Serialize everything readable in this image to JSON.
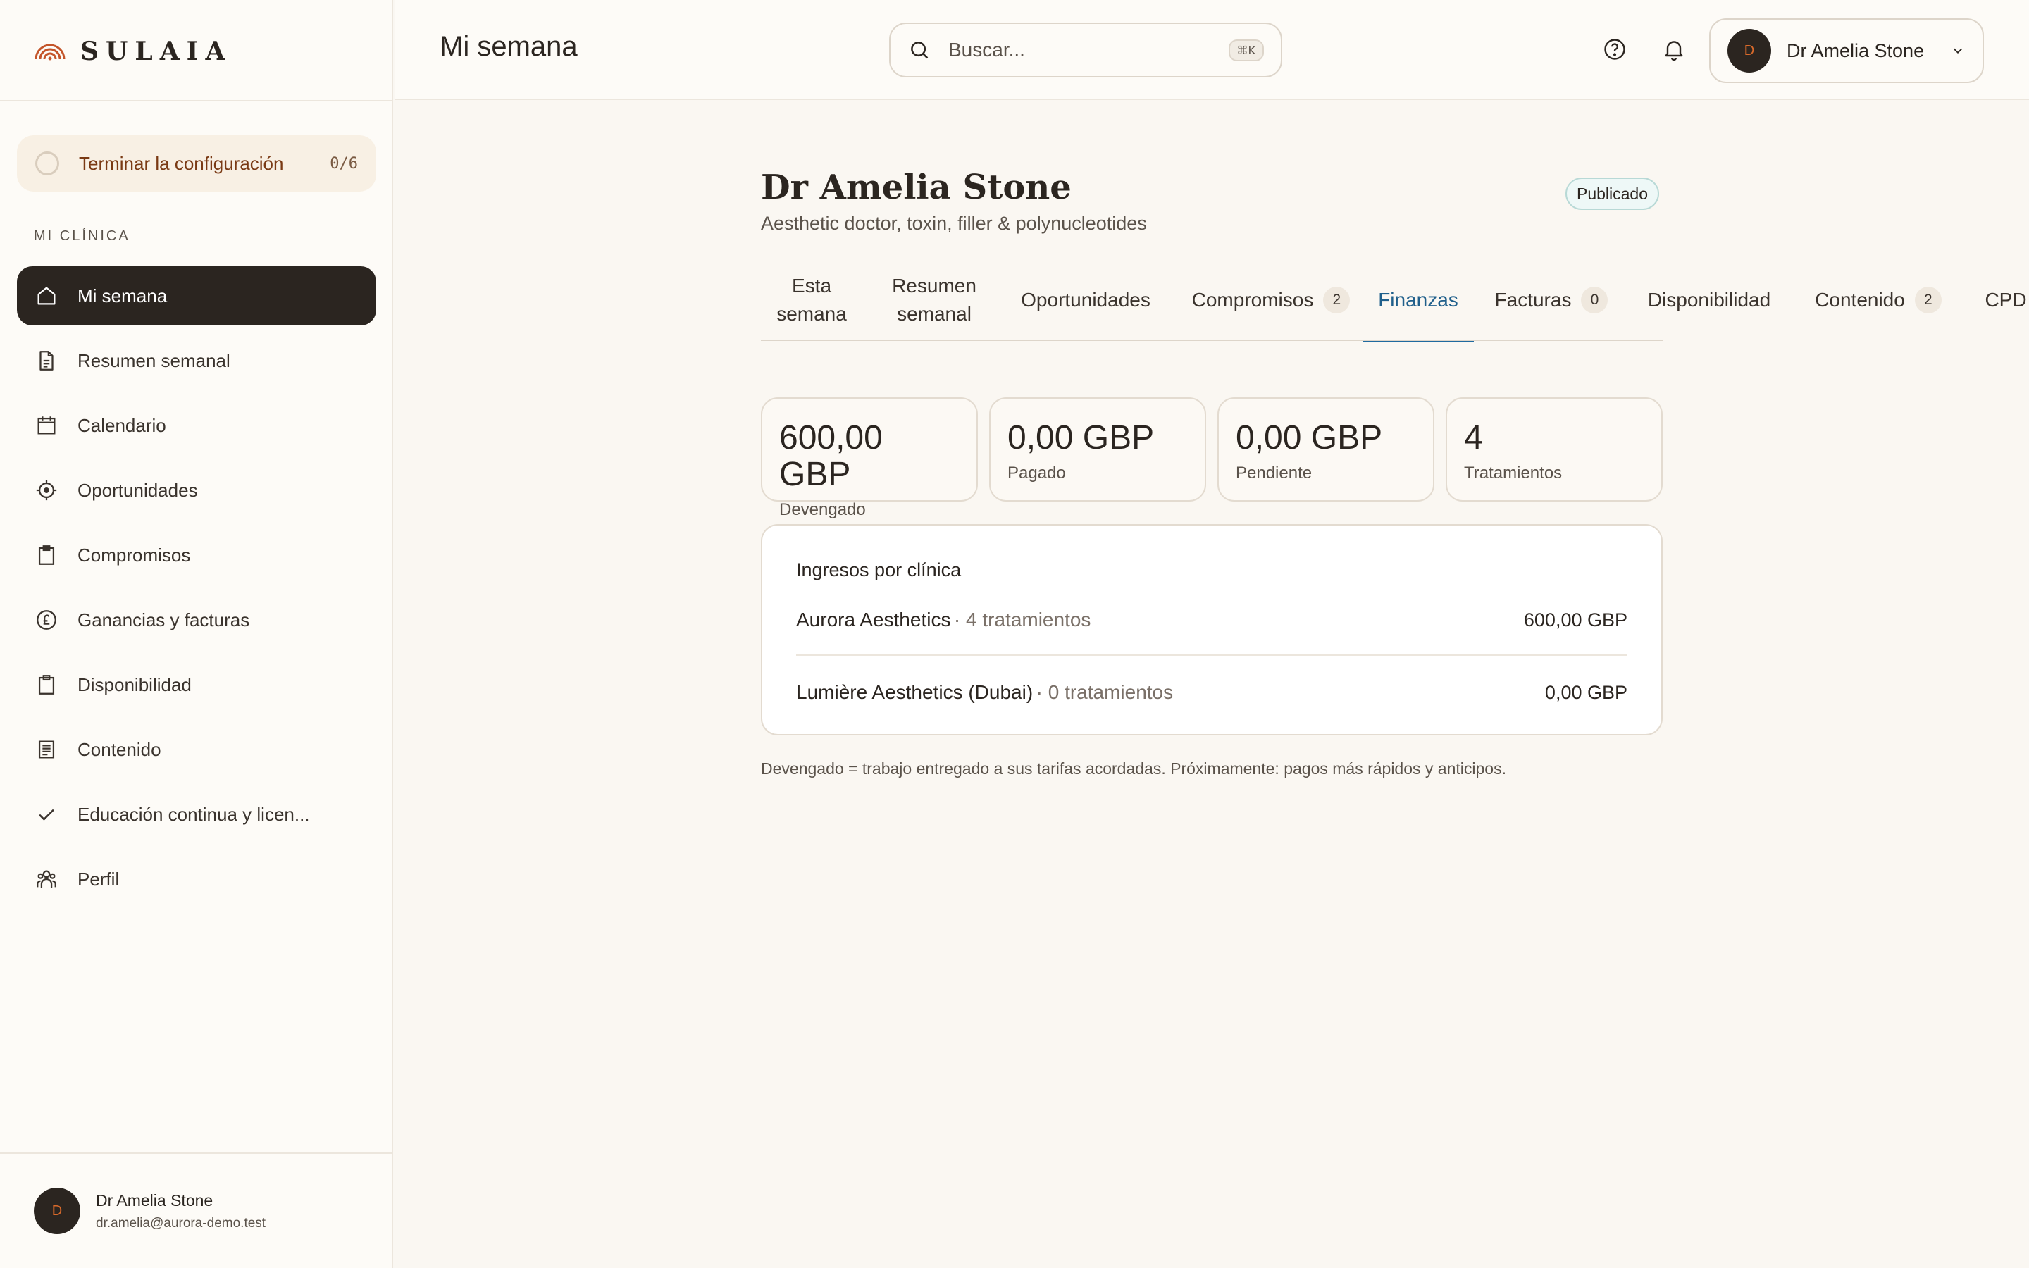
{
  "app": {
    "logo_text": "SULAIA"
  },
  "sidebar": {
    "setup": {
      "label": "Terminar la configuración",
      "count": "0/6"
    },
    "section_label": "MI CLÍNICA",
    "items": [
      {
        "label": "Mi semana",
        "icon": "home-icon"
      },
      {
        "label": "Resumen semanal",
        "icon": "document-icon"
      },
      {
        "label": "Calendario",
        "icon": "calendar-icon"
      },
      {
        "label": "Oportunidades",
        "icon": "target-icon"
      },
      {
        "label": "Compromisos",
        "icon": "clipboard-icon"
      },
      {
        "label": "Ganancias y facturas",
        "icon": "pound-icon"
      },
      {
        "label": "Disponibilidad",
        "icon": "clipboard-icon"
      },
      {
        "label": "Contenido",
        "icon": "newspaper-icon"
      },
      {
        "label": "Educación continua y licen...",
        "icon": "check-icon"
      },
      {
        "label": "Perfil",
        "icon": "users-icon"
      }
    ],
    "user": {
      "initial": "D",
      "name": "Dr Amelia Stone",
      "email": "dr.amelia@aurora-demo.test"
    }
  },
  "header": {
    "title": "Mi semana",
    "search": {
      "placeholder": "Buscar...",
      "shortcut": "⌘K"
    },
    "user": {
      "initial": "D",
      "name": "Dr Amelia Stone"
    }
  },
  "profile": {
    "name": "Dr Amelia Stone",
    "subtitle": "Aesthetic doctor, toxin, filler & polynucleotides",
    "status": "Publicado"
  },
  "tabs": [
    {
      "label": "Esta semana"
    },
    {
      "label": "Resumen semanal"
    },
    {
      "label": "Oportunidades"
    },
    {
      "label": "Compromisos",
      "count": "2"
    },
    {
      "label": "Finanzas",
      "active": true
    },
    {
      "label": "Facturas",
      "count": "0"
    },
    {
      "label": "Disponibilidad"
    },
    {
      "label": "Contenido",
      "count": "2"
    },
    {
      "label": "CPD"
    }
  ],
  "stats": [
    {
      "value": "600,00 GBP",
      "label": "Devengado"
    },
    {
      "value": "0,00 GBP",
      "label": "Pagado"
    },
    {
      "value": "0,00 GBP",
      "label": "Pendiente"
    },
    {
      "value": "4",
      "label": "Tratamientos"
    }
  ],
  "revenue": {
    "title": "Ingresos por clínica",
    "rows": [
      {
        "clinic": "Aurora Aesthetics",
        "meta": "· 4 tratamientos",
        "amount": "600,00 GBP"
      },
      {
        "clinic": "Lumière Aesthetics (Dubai)",
        "meta": "· 0 tratamientos",
        "amount": "0,00 GBP"
      }
    ]
  },
  "footnote": "Devengado = trabajo entregado a sus tarifas acordadas. Próximamente: pagos más rápidos y anticipos.",
  "colors": {
    "accent": "#1f6aa0",
    "dark": "#2b2520",
    "brand_orange": "#d96a2b",
    "page_bg": "#faf7f2"
  }
}
